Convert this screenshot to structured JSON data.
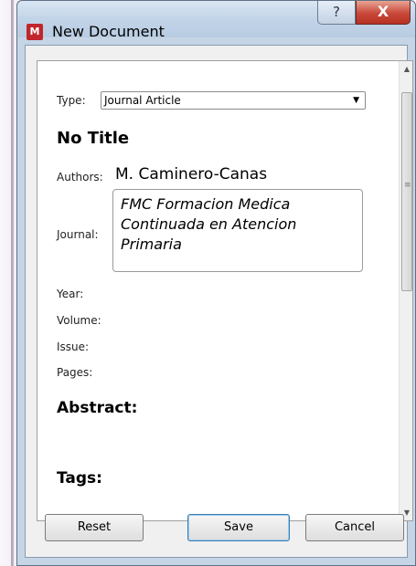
{
  "window": {
    "title": "New Document",
    "app_icon_letter": "M",
    "help_glyph": "?",
    "close_glyph": "X"
  },
  "form": {
    "type_label": "Type:",
    "type_value": "Journal Article",
    "title": "No Title",
    "authors_label": "Authors:",
    "authors_value": "M. Caminero-Canas",
    "journal_label": "Journal:",
    "journal_value": "FMC Formacion Medica Continuada en Atencion Primaria",
    "year_label": "Year:",
    "volume_label": "Volume:",
    "issue_label": "Issue:",
    "pages_label": "Pages:",
    "abstract_label": "Abstract:",
    "tags_label": "Tags:"
  },
  "buttons": {
    "reset": "Reset",
    "save": "Save",
    "cancel": "Cancel"
  },
  "colors": {
    "close_button": "#c8483a",
    "titlebar": "#c2d4e8",
    "app_icon": "#c0262c"
  }
}
